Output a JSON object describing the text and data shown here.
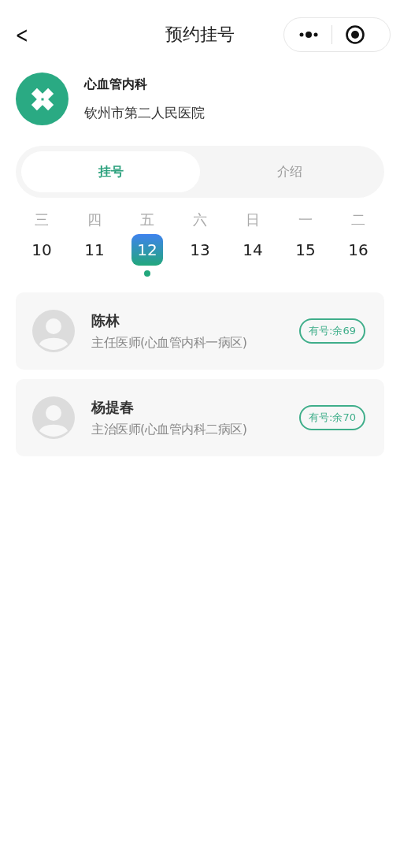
{
  "nav": {
    "back": "<",
    "title": "预约挂号"
  },
  "department": {
    "name": "心血管内科",
    "hospital": "钦州市第二人民医院"
  },
  "tabs": [
    {
      "label": "挂号",
      "selected": true
    },
    {
      "label": "介绍",
      "selected": false
    }
  ],
  "days": [
    {
      "weekday": "三",
      "date": "10",
      "selected": false,
      "marked": false
    },
    {
      "weekday": "四",
      "date": "11",
      "selected": false,
      "marked": false
    },
    {
      "weekday": "五",
      "date": "12",
      "selected": true,
      "marked": true
    },
    {
      "weekday": "六",
      "date": "13",
      "selected": false,
      "marked": false
    },
    {
      "weekday": "日",
      "date": "14",
      "selected": false,
      "marked": false
    },
    {
      "weekday": "一",
      "date": "15",
      "selected": false,
      "marked": false
    },
    {
      "weekday": "二",
      "date": "16",
      "selected": false,
      "marked": false
    }
  ],
  "doctors": [
    {
      "name": "陈林",
      "title": "主任医师(心血管内科一病区)",
      "availability": "有号:余69"
    },
    {
      "name": "杨提春",
      "title": "主治医师(心血管内科二病区)",
      "availability": "有号:余70"
    }
  ]
}
